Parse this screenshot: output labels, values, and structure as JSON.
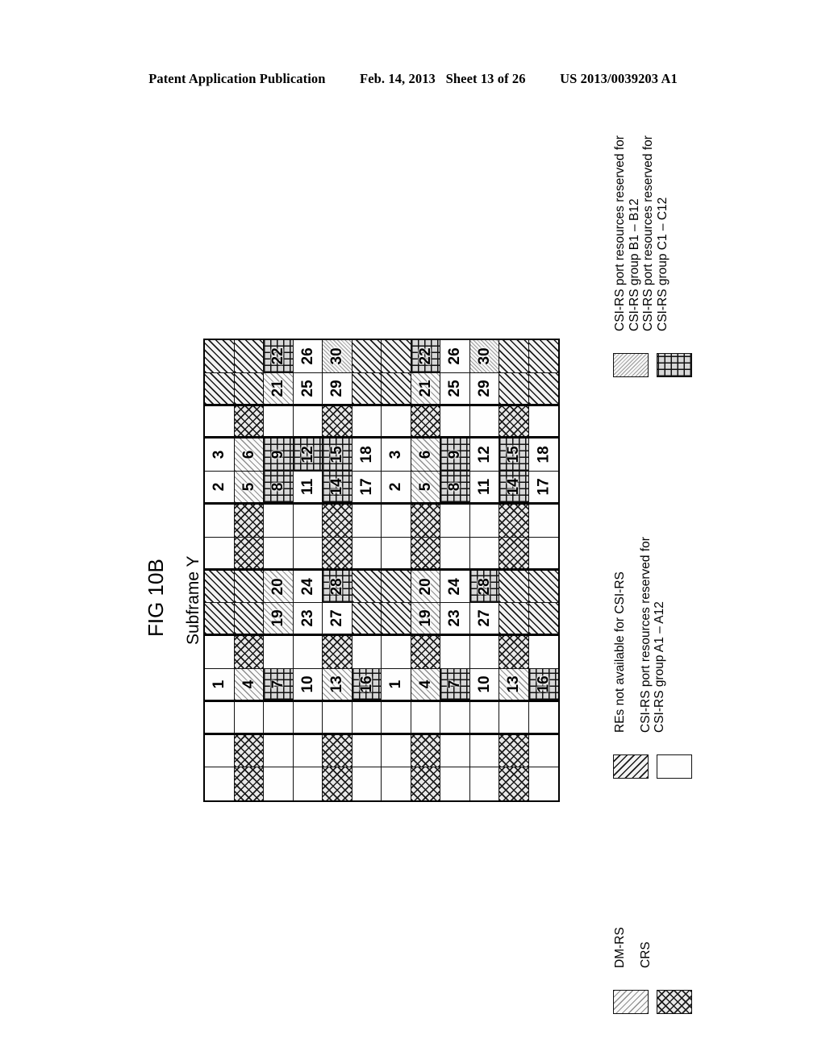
{
  "header": {
    "publication": "Patent Application Publication",
    "date": "Feb. 14, 2013",
    "sheet": "Sheet 13 of 26",
    "patent_number": "US 2013/0039203 A1"
  },
  "figure": {
    "title": "FIG 10B",
    "subtitle": "Subframe Y"
  },
  "legend": {
    "na_label": "REs not available for CSI-RS",
    "group_a_label": "CSI-RS port resources reserved for\nCSI-RS group A1 – A12",
    "group_a_line1": "CSI-RS port resources reserved for",
    "group_a_line2": "CSI-RS group A1 – A12",
    "group_b_line1": "CSI-RS port resources reserved for",
    "group_b_line2": "CSI-RS group B1 – B12",
    "group_c_line1": "CSI-RS port resources reserved for",
    "group_c_line2": "CSI-RS group C1 – C12",
    "dmrs_label": "DM-RS",
    "crs_label": "CRS"
  },
  "patterns": {
    "empty": "p-white",
    "not_available": "p-na",
    "group_a": "p-a",
    "group_b": "p-b",
    "group_c": "p-c",
    "crs": "p-crs"
  },
  "grid": {
    "cols": 12,
    "rows": 14,
    "note": "cells listed image-row by image-row, left to right; f = fill pattern key, t = text label",
    "cells": [
      [
        {
          "f": "not_available",
          "t": ""
        },
        {
          "f": "not_available",
          "t": ""
        },
        {
          "f": "group_c",
          "t": "22"
        },
        {
          "f": "empty",
          "t": "26"
        },
        {
          "f": "group_b",
          "t": "30"
        },
        {
          "f": "not_available",
          "t": ""
        },
        {
          "f": "not_available",
          "t": ""
        },
        {
          "f": "group_c",
          "t": "22"
        },
        {
          "f": "empty",
          "t": "26"
        },
        {
          "f": "group_b",
          "t": "30"
        },
        {
          "f": "not_available",
          "t": ""
        },
        {
          "f": "not_available",
          "t": ""
        }
      ],
      [
        {
          "f": "not_available",
          "t": ""
        },
        {
          "f": "not_available",
          "t": ""
        },
        {
          "f": "group_a",
          "t": "21"
        },
        {
          "f": "empty",
          "t": "25"
        },
        {
          "f": "empty",
          "t": "29"
        },
        {
          "f": "not_available",
          "t": ""
        },
        {
          "f": "not_available",
          "t": ""
        },
        {
          "f": "group_a",
          "t": "21"
        },
        {
          "f": "empty",
          "t": "25"
        },
        {
          "f": "empty",
          "t": "29"
        },
        {
          "f": "not_available",
          "t": ""
        },
        {
          "f": "not_available",
          "t": ""
        }
      ],
      [
        {
          "f": "empty",
          "t": ""
        },
        {
          "f": "crs",
          "t": ""
        },
        {
          "f": "empty",
          "t": ""
        },
        {
          "f": "empty",
          "t": ""
        },
        {
          "f": "crs",
          "t": ""
        },
        {
          "f": "empty",
          "t": ""
        },
        {
          "f": "empty",
          "t": ""
        },
        {
          "f": "crs",
          "t": ""
        },
        {
          "f": "empty",
          "t": ""
        },
        {
          "f": "empty",
          "t": ""
        },
        {
          "f": "crs",
          "t": ""
        },
        {
          "f": "empty",
          "t": ""
        }
      ],
      [
        {
          "f": "empty",
          "t": "3"
        },
        {
          "f": "group_a",
          "t": "6"
        },
        {
          "f": "group_c",
          "t": "9"
        },
        {
          "f": "group_c",
          "t": "12"
        },
        {
          "f": "group_c",
          "t": "15"
        },
        {
          "f": "empty",
          "t": "18"
        },
        {
          "f": "empty",
          "t": "3"
        },
        {
          "f": "group_a",
          "t": "6"
        },
        {
          "f": "group_c",
          "t": "9"
        },
        {
          "f": "empty",
          "t": "12"
        },
        {
          "f": "group_c",
          "t": "15"
        },
        {
          "f": "empty",
          "t": "18"
        }
      ],
      [
        {
          "f": "empty",
          "t": "2"
        },
        {
          "f": "group_a",
          "t": "5"
        },
        {
          "f": "group_c",
          "t": "8"
        },
        {
          "f": "empty",
          "t": "11"
        },
        {
          "f": "group_c",
          "t": "14"
        },
        {
          "f": "empty",
          "t": "17"
        },
        {
          "f": "empty",
          "t": "2"
        },
        {
          "f": "group_a",
          "t": "5"
        },
        {
          "f": "group_c",
          "t": "8"
        },
        {
          "f": "empty",
          "t": "11"
        },
        {
          "f": "group_c",
          "t": "14"
        },
        {
          "f": "empty",
          "t": "17"
        }
      ],
      [
        {
          "f": "empty",
          "t": ""
        },
        {
          "f": "crs",
          "t": ""
        },
        {
          "f": "empty",
          "t": ""
        },
        {
          "f": "empty",
          "t": ""
        },
        {
          "f": "crs",
          "t": ""
        },
        {
          "f": "empty",
          "t": ""
        },
        {
          "f": "empty",
          "t": ""
        },
        {
          "f": "crs",
          "t": ""
        },
        {
          "f": "empty",
          "t": ""
        },
        {
          "f": "empty",
          "t": ""
        },
        {
          "f": "crs",
          "t": ""
        },
        {
          "f": "empty",
          "t": ""
        }
      ],
      [
        {
          "f": "empty",
          "t": ""
        },
        {
          "f": "crs",
          "t": ""
        },
        {
          "f": "empty",
          "t": ""
        },
        {
          "f": "empty",
          "t": ""
        },
        {
          "f": "crs",
          "t": ""
        },
        {
          "f": "empty",
          "t": ""
        },
        {
          "f": "empty",
          "t": ""
        },
        {
          "f": "crs",
          "t": ""
        },
        {
          "f": "empty",
          "t": ""
        },
        {
          "f": "empty",
          "t": ""
        },
        {
          "f": "crs",
          "t": ""
        },
        {
          "f": "empty",
          "t": ""
        }
      ],
      [
        {
          "f": "not_available",
          "t": ""
        },
        {
          "f": "not_available",
          "t": ""
        },
        {
          "f": "group_a",
          "t": "20"
        },
        {
          "f": "empty",
          "t": "24"
        },
        {
          "f": "group_c",
          "t": "28"
        },
        {
          "f": "not_available",
          "t": ""
        },
        {
          "f": "not_available",
          "t": ""
        },
        {
          "f": "group_a",
          "t": "20"
        },
        {
          "f": "empty",
          "t": "24"
        },
        {
          "f": "group_c",
          "t": "28"
        },
        {
          "f": "not_available",
          "t": ""
        },
        {
          "f": "not_available",
          "t": ""
        }
      ],
      [
        {
          "f": "not_available",
          "t": ""
        },
        {
          "f": "not_available",
          "t": ""
        },
        {
          "f": "group_a",
          "t": "19"
        },
        {
          "f": "empty",
          "t": "23"
        },
        {
          "f": "empty",
          "t": "27"
        },
        {
          "f": "not_available",
          "t": ""
        },
        {
          "f": "not_available",
          "t": ""
        },
        {
          "f": "group_a",
          "t": "19"
        },
        {
          "f": "empty",
          "t": "23"
        },
        {
          "f": "empty",
          "t": "27"
        },
        {
          "f": "not_available",
          "t": ""
        },
        {
          "f": "not_available",
          "t": ""
        }
      ],
      [
        {
          "f": "empty",
          "t": ""
        },
        {
          "f": "crs",
          "t": ""
        },
        {
          "f": "empty",
          "t": ""
        },
        {
          "f": "empty",
          "t": ""
        },
        {
          "f": "crs",
          "t": ""
        },
        {
          "f": "empty",
          "t": ""
        },
        {
          "f": "empty",
          "t": ""
        },
        {
          "f": "crs",
          "t": ""
        },
        {
          "f": "empty",
          "t": ""
        },
        {
          "f": "empty",
          "t": ""
        },
        {
          "f": "crs",
          "t": ""
        },
        {
          "f": "empty",
          "t": ""
        }
      ],
      [
        {
          "f": "empty",
          "t": "1"
        },
        {
          "f": "group_a",
          "t": "4"
        },
        {
          "f": "group_c",
          "t": "7"
        },
        {
          "f": "empty",
          "t": "10"
        },
        {
          "f": "group_a",
          "t": "13"
        },
        {
          "f": "group_c",
          "t": "16"
        },
        {
          "f": "empty",
          "t": "1"
        },
        {
          "f": "group_a",
          "t": "4"
        },
        {
          "f": "group_c",
          "t": "7"
        },
        {
          "f": "empty",
          "t": "10"
        },
        {
          "f": "group_a",
          "t": "13"
        },
        {
          "f": "group_c",
          "t": "16"
        }
      ],
      [
        {
          "f": "empty",
          "t": ""
        },
        {
          "f": "empty",
          "t": ""
        },
        {
          "f": "empty",
          "t": ""
        },
        {
          "f": "empty",
          "t": ""
        },
        {
          "f": "empty",
          "t": ""
        },
        {
          "f": "empty",
          "t": ""
        },
        {
          "f": "empty",
          "t": ""
        },
        {
          "f": "empty",
          "t": ""
        },
        {
          "f": "empty",
          "t": ""
        },
        {
          "f": "empty",
          "t": ""
        },
        {
          "f": "empty",
          "t": ""
        },
        {
          "f": "empty",
          "t": ""
        }
      ],
      [
        {
          "f": "empty",
          "t": ""
        },
        {
          "f": "crs",
          "t": ""
        },
        {
          "f": "empty",
          "t": ""
        },
        {
          "f": "empty",
          "t": ""
        },
        {
          "f": "crs",
          "t": ""
        },
        {
          "f": "empty",
          "t": ""
        },
        {
          "f": "empty",
          "t": ""
        },
        {
          "f": "crs",
          "t": ""
        },
        {
          "f": "empty",
          "t": ""
        },
        {
          "f": "empty",
          "t": ""
        },
        {
          "f": "crs",
          "t": ""
        },
        {
          "f": "empty",
          "t": ""
        }
      ],
      [
        {
          "f": "empty",
          "t": ""
        },
        {
          "f": "crs",
          "t": ""
        },
        {
          "f": "empty",
          "t": ""
        },
        {
          "f": "empty",
          "t": ""
        },
        {
          "f": "crs",
          "t": ""
        },
        {
          "f": "empty",
          "t": ""
        },
        {
          "f": "empty",
          "t": ""
        },
        {
          "f": "crs",
          "t": ""
        },
        {
          "f": "empty",
          "t": ""
        },
        {
          "f": "empty",
          "t": ""
        },
        {
          "f": "crs",
          "t": ""
        },
        {
          "f": "empty",
          "t": ""
        }
      ]
    ],
    "band_end_rows": [
      1,
      2,
      4,
      6,
      8,
      10,
      11,
      13
    ]
  }
}
